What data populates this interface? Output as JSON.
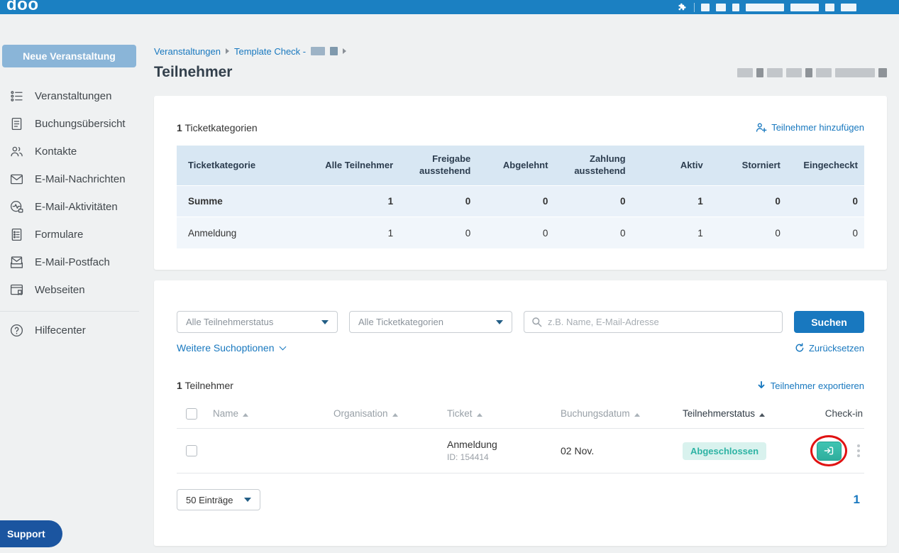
{
  "topbar": {
    "logo": "doo",
    "accent": "#1b80c2"
  },
  "sidebar": {
    "new_event": "Neue Veranstaltung",
    "items": [
      {
        "label": "Veranstaltungen"
      },
      {
        "label": "Buchungsübersicht"
      },
      {
        "label": "Kontakte"
      },
      {
        "label": "E-Mail-Nachrichten"
      },
      {
        "label": "E-Mail-Aktivitäten"
      },
      {
        "label": "Formulare"
      },
      {
        "label": "E-Mail-Postfach"
      },
      {
        "label": "Webseiten"
      }
    ],
    "help": "Hilfecenter",
    "support": "Support"
  },
  "breadcrumb": {
    "events": "Veranstaltungen",
    "event_name": "Template Check -"
  },
  "page": {
    "title": "Teilnehmer"
  },
  "categories_card": {
    "count": "1",
    "count_label": "Ticketkategorien",
    "add_participant": "Teilnehmer hinzufügen",
    "headers": [
      "Ticketkategorie",
      "Alle Teilnehmer",
      "Freigabe ausstehend",
      "Abgelehnt",
      "Zahlung ausstehend",
      "Aktiv",
      "Storniert",
      "Eingecheckt"
    ],
    "rows": [
      {
        "name": "Summe",
        "values": [
          "1",
          "0",
          "0",
          "0",
          "1",
          "0",
          "0"
        ]
      },
      {
        "name": "Anmeldung",
        "values": [
          "1",
          "0",
          "0",
          "0",
          "1",
          "0",
          "0"
        ]
      }
    ]
  },
  "filter": {
    "status_dropdown": "Alle Teilnehmerstatus",
    "category_dropdown": "Alle Ticketkategorien",
    "search_placeholder": "z.B. Name, E-Mail-Adresse",
    "search_button": "Suchen",
    "more_options": "Weitere Suchoptionen",
    "reset": "Zurücksetzen"
  },
  "participants_card": {
    "count": "1",
    "count_label": "Teilnehmer",
    "export": "Teilnehmer exportieren",
    "headers": [
      "Name",
      "Organisation",
      "Ticket",
      "Buchungsdatum",
      "Teilnehmerstatus",
      "Check-in"
    ],
    "row": {
      "ticket": "Anmeldung",
      "ticket_id": "ID: 154414",
      "date": "02 Nov.",
      "status": "Abgeschlossen"
    },
    "page_size": "50 Einträge",
    "page_number": "1"
  }
}
